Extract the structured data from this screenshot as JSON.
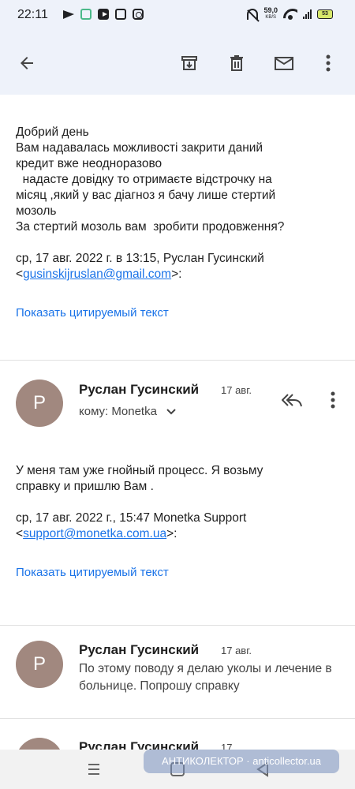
{
  "status_bar": {
    "time": "22:11",
    "speed_value": "59,0",
    "speed_unit": "KB/S",
    "battery": "53"
  },
  "email1": {
    "body": "Добрий день\nВам надавалась можливості закрити даний\nкредит вже неодноразово\n  надасте довідку то отримаєте відстрочку на\nмісяц ,який у вас діагноз я бачу лише стертий\nмозоль\nЗа стертий мозоль вам  зробити продовження?",
    "quote_header": "ср, 17 авг. 2022 г. в 13:15, Руслан Гусинский",
    "quote_email": "gusinskijruslan@gmail.com",
    "quote_open": "<",
    "quote_close": ">:",
    "show_quoted": "Показать цитируемый текст"
  },
  "email2": {
    "avatar_letter": "Р",
    "sender": "Руслан Гусинский",
    "date": "17 авг.",
    "to": "кому: Monetka",
    "body": "У меня там уже гнойный процесс. Я возьму\nсправку и пришлю Вам .",
    "quote_header": "ср, 17 авг. 2022 г., 15:47 Monetka Support",
    "quote_email": "support@monetka.com.ua",
    "quote_open": "<",
    "quote_close": ">:",
    "show_quoted": "Показать цитируемый текст"
  },
  "email3": {
    "avatar_letter": "Р",
    "sender": "Руслан Гусинский",
    "date": "17 авг.",
    "snippet": "По этому поводу я делаю уколы и лечение в больнице. Попрошу справку"
  },
  "email4": {
    "avatar_letter": "Р",
    "sender": "Руслан Гусинский",
    "date": "17"
  },
  "watermark": "АНТИКОЛЕКТОР · anticollector.ua",
  "colors": {
    "app_bar": "#eef2fa",
    "link": "#1a73e8",
    "avatar": "#a1887f"
  }
}
